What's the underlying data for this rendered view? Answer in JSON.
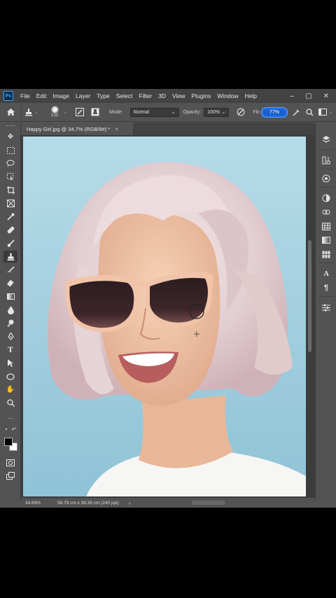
{
  "app": {
    "logo_text": "Ps"
  },
  "menu": [
    "File",
    "Edit",
    "Image",
    "Layer",
    "Type",
    "Select",
    "Filter",
    "3D",
    "View",
    "Plugins",
    "Window",
    "Help"
  ],
  "window_controls": {
    "minimize": "–",
    "maximize": "▢",
    "close": "✕"
  },
  "options_bar": {
    "brush_size": "133",
    "mode_label": "Mode:",
    "mode_value": "Normal",
    "opacity_label": "Opacity:",
    "opacity_value": "100%",
    "flow_label": "Flo",
    "flow_value": "77%"
  },
  "document_tab": {
    "title": "Happy Girl.jpg @ 34.7% (RGB/8#) *",
    "close": "×"
  },
  "status": {
    "zoom": "34.69%",
    "doc_size": "58.79 cm x 39.39 cm (240 ppi)",
    "arrow": "›"
  },
  "icons": {
    "home": "home-icon",
    "clone_stamp": "clone-stamp-icon",
    "brush_settings": "brush-settings-icon",
    "clone_source": "clone-source-icon",
    "airbrush": "airbrush-icon",
    "search": "search-icon",
    "workspace": "workspace-icon"
  },
  "colors": {
    "accent": "#1f6fe8",
    "background_photo": "#a9d3e2",
    "ui_dark": "#535353"
  }
}
